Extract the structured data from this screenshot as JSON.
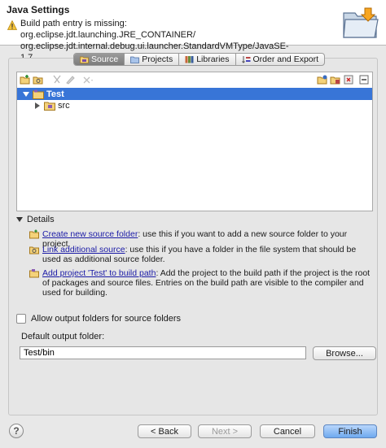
{
  "window": {
    "title": "Java Settings",
    "message": "Build path entry is missing: org.eclipse.jdt.launching.JRE_CONTAINER/ org.eclipse.jdt.internal.debug.ui.launcher.StandardVMType/JavaSE-1.7"
  },
  "tabs": [
    {
      "label": "Source",
      "icon": "source-folder-icon",
      "active": true
    },
    {
      "label": "Projects",
      "icon": "projects-icon",
      "active": false
    },
    {
      "label": "Libraries",
      "icon": "libraries-icon",
      "active": false
    },
    {
      "label": "Order and Export",
      "icon": "order-export-icon",
      "active": false
    }
  ],
  "tree": {
    "items": [
      {
        "label": "Test",
        "expanded": true,
        "selected": true,
        "icon": "project-folder-icon"
      },
      {
        "label": "src",
        "expanded": false,
        "selected": false,
        "icon": "package-folder-icon"
      }
    ]
  },
  "details": {
    "label": "Details",
    "items": [
      {
        "link": "Create new source folder",
        "text": ": use this if you want to add a new source folder to your project.",
        "icon": "new-source-folder-icon"
      },
      {
        "link": "Link additional source",
        "text": ": use this if you have a folder in the file system that should be used as additional source folder.",
        "icon": "link-source-icon"
      },
      {
        "link": "Add project 'Test' to build path",
        "text": ": Add the project to the build path if the project is the root of packages and source files. Entries on the build path are visible to the compiler and used for building.",
        "icon": "add-project-icon"
      }
    ]
  },
  "allow_output": {
    "label": "Allow output folders for source folders",
    "checked": false
  },
  "output_folder": {
    "label": "Default output folder:",
    "value": "Test/bin"
  },
  "buttons": {
    "browse": "Browse...",
    "back": "< Back",
    "next": "Next >",
    "cancel": "Cancel",
    "finish": "Finish"
  },
  "colors": {
    "selection": "#3875d7",
    "link": "#1a1aa6",
    "accent": "#6fa9ef"
  }
}
